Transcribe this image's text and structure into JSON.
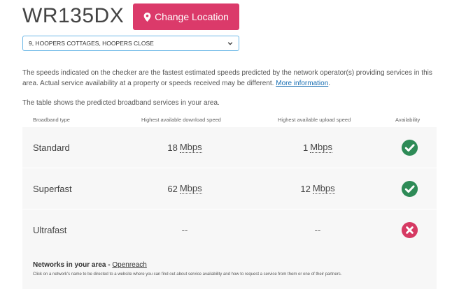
{
  "header": {
    "postcode": "WR135DX",
    "change_location_label": "Change Location"
  },
  "address_select": {
    "selected": "9, HOOPERS COTTAGES, HOOPERS CLOSE"
  },
  "info": {
    "text": "The speeds indicated on the checker are the fastest estimated speeds predicted by the network operator(s) providing services in this area. Actual service availability at a property or speeds received may be different. ",
    "link_text": "More information",
    "after_link": ".",
    "table_intro": "The table shows the predicted broadband services in your area."
  },
  "table": {
    "headers": [
      "Broadband type",
      "Highest available download speed",
      "Highest available upload speed",
      "Availability"
    ],
    "rows": [
      {
        "type": "Standard",
        "download": "18",
        "download_unit": "Mbps",
        "upload": "1",
        "upload_unit": "Mbps",
        "available": true
      },
      {
        "type": "Superfast",
        "download": "62",
        "download_unit": "Mbps",
        "upload": "12",
        "upload_unit": "Mbps",
        "available": true
      },
      {
        "type": "Ultrafast",
        "download": "--",
        "download_unit": "",
        "upload": "--",
        "upload_unit": "",
        "available": false
      }
    ]
  },
  "networks": {
    "title": "Networks in your area - ",
    "operator": "Openreach",
    "note": "Click on a network's name to be directed to a website where you can find out about service availability and how to request a service from them or one of their partners."
  },
  "colors": {
    "accent": "#db3a6a",
    "available": "#2e8b57",
    "unavailable": "#d63a63",
    "link": "#1a6fb3"
  },
  "icons": {
    "button": "map-marker-icon",
    "select": "chevron-down-icon",
    "available": "check-circle-icon",
    "unavailable": "cross-circle-icon"
  }
}
